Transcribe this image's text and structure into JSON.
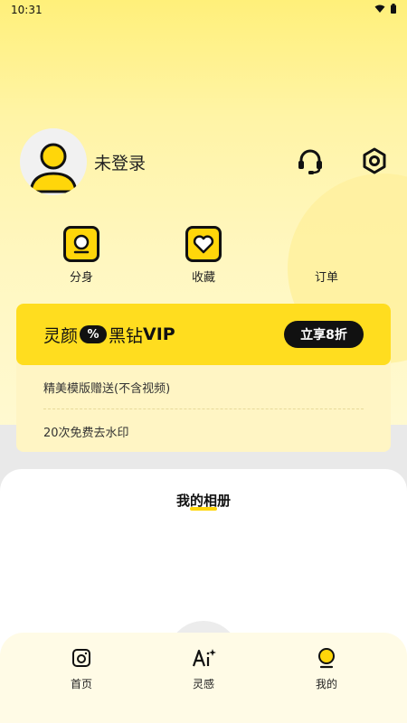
{
  "status_bar": {
    "time": "10:31",
    "icons": [
      "wifi-icon",
      "battery-icon"
    ]
  },
  "profile": {
    "username": "未登录",
    "avatar_icon": "user-icon"
  },
  "header_actions": [
    {
      "name": "headset-icon"
    },
    {
      "name": "settings-icon"
    }
  ],
  "shortcuts": [
    {
      "label": "分身",
      "icon": "clone-icon"
    },
    {
      "label": "收藏",
      "icon": "heart-icon"
    },
    {
      "label": "订单",
      "icon": "order-icon"
    }
  ],
  "vip": {
    "title_prefix": "灵颜",
    "badge_symbol": "%",
    "title_middle": "黑钻",
    "title_suffix": "VIP",
    "cta": "立享8折",
    "benefits": [
      "精美模版赠送(不含视频)",
      "20次免费去水印"
    ]
  },
  "album": {
    "title": "我的相册"
  },
  "tabbar": {
    "items": [
      {
        "label": "首页",
        "icon": "camera-icon"
      },
      {
        "label": "灵感",
        "icon": "ai-icon"
      },
      {
        "label": "我的",
        "icon": "profile-icon"
      }
    ]
  },
  "colors": {
    "accent": "#ffd60a",
    "dark": "#111111",
    "card": "#fff5c4"
  }
}
